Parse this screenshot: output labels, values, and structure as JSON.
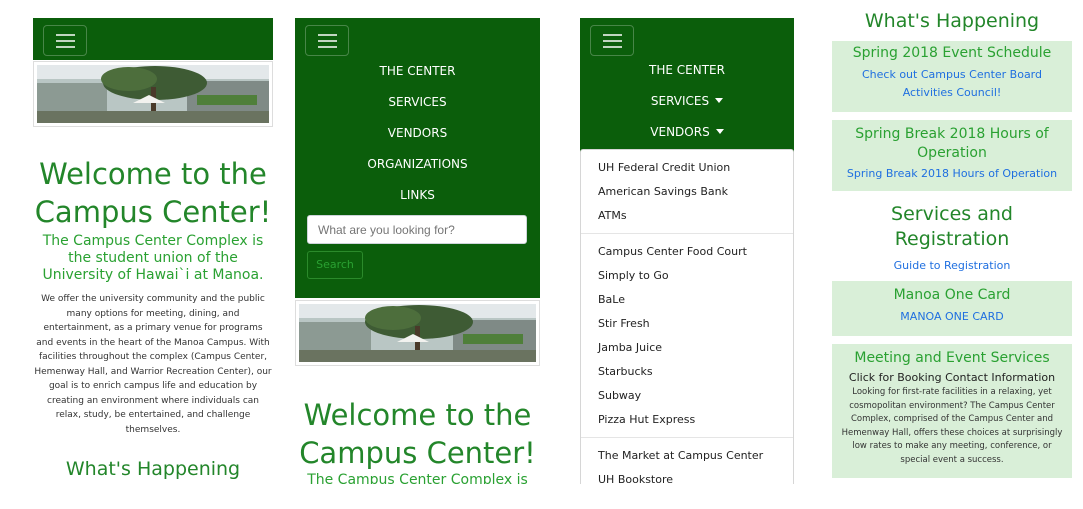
{
  "navbar": {
    "toggle_icon": "hamburger-menu-icon",
    "links": [
      "THE CENTER",
      "SERVICES",
      "VENDORS",
      "ORGANIZATIONS",
      "LINKS"
    ],
    "search_placeholder": "What are you looking for?",
    "search_button": "Search"
  },
  "banner": {
    "image": "campus-center-courtyard-photo"
  },
  "welcome": {
    "title_line1": "Welcome to the",
    "title_line2": "Campus Center!",
    "tagline": "The Campus Center Complex is the student union of the University of Hawai`i at Manoa.",
    "tagline_cut": "The Campus Center Complex is the",
    "body": "We offer the university community and the public many options for meeting, dining, and entertainment, as a primary venue for programs and events in the heart of the Manoa Campus. With facilities throughout the complex (Campus Center, Hemenway Hall, and Warrior Recreation Center), our goal is to enrich campus life and education by creating an environment where individuals can relax, study, be entertained, and challenge themselves."
  },
  "whats_happening": "What's Happening",
  "vendors_dropdown": {
    "group1": [
      "UH Federal Credit Union",
      "American Savings Bank",
      "ATMs"
    ],
    "group2": [
      "Campus Center Food Court",
      "Simply to Go",
      "BaLe",
      "Stir Fresh",
      "Jamba Juice",
      "Starbucks",
      "Subway",
      "Pizza Hut Express"
    ],
    "group3": [
      "The Market at Campus Center",
      "UH Bookstore"
    ]
  },
  "happenings": {
    "spring_schedule": {
      "title": "Spring 2018 Event Schedule",
      "link": "Check out Campus Center Board Activities Council!"
    },
    "spring_break": {
      "title": "Spring Break 2018 Hours of Operation",
      "link": "Spring Break 2018 Hours of Operation"
    },
    "services": {
      "title": "Services and Registration",
      "link": "Guide to Registration"
    },
    "manoa_card": {
      "title": "Manoa One Card",
      "link": "MANOA ONE CARD"
    },
    "meeting": {
      "title": "Meeting and Event Services",
      "subtitle": "Click for Booking Contact Information",
      "body": "Looking for first-rate facilities in a relaxing, yet cosmopolitan environment? The Campus Center Complex, comprised of the Campus Center and Hemenway Hall, offers these choices at surprisingly low rates to make any meeting, conference, or special event a success."
    }
  },
  "colors": {
    "nav_green": "#0b5e0b",
    "heading_green": "#23862a",
    "light_green_card": "#d9efd8",
    "link_blue": "#1f6fe0"
  }
}
